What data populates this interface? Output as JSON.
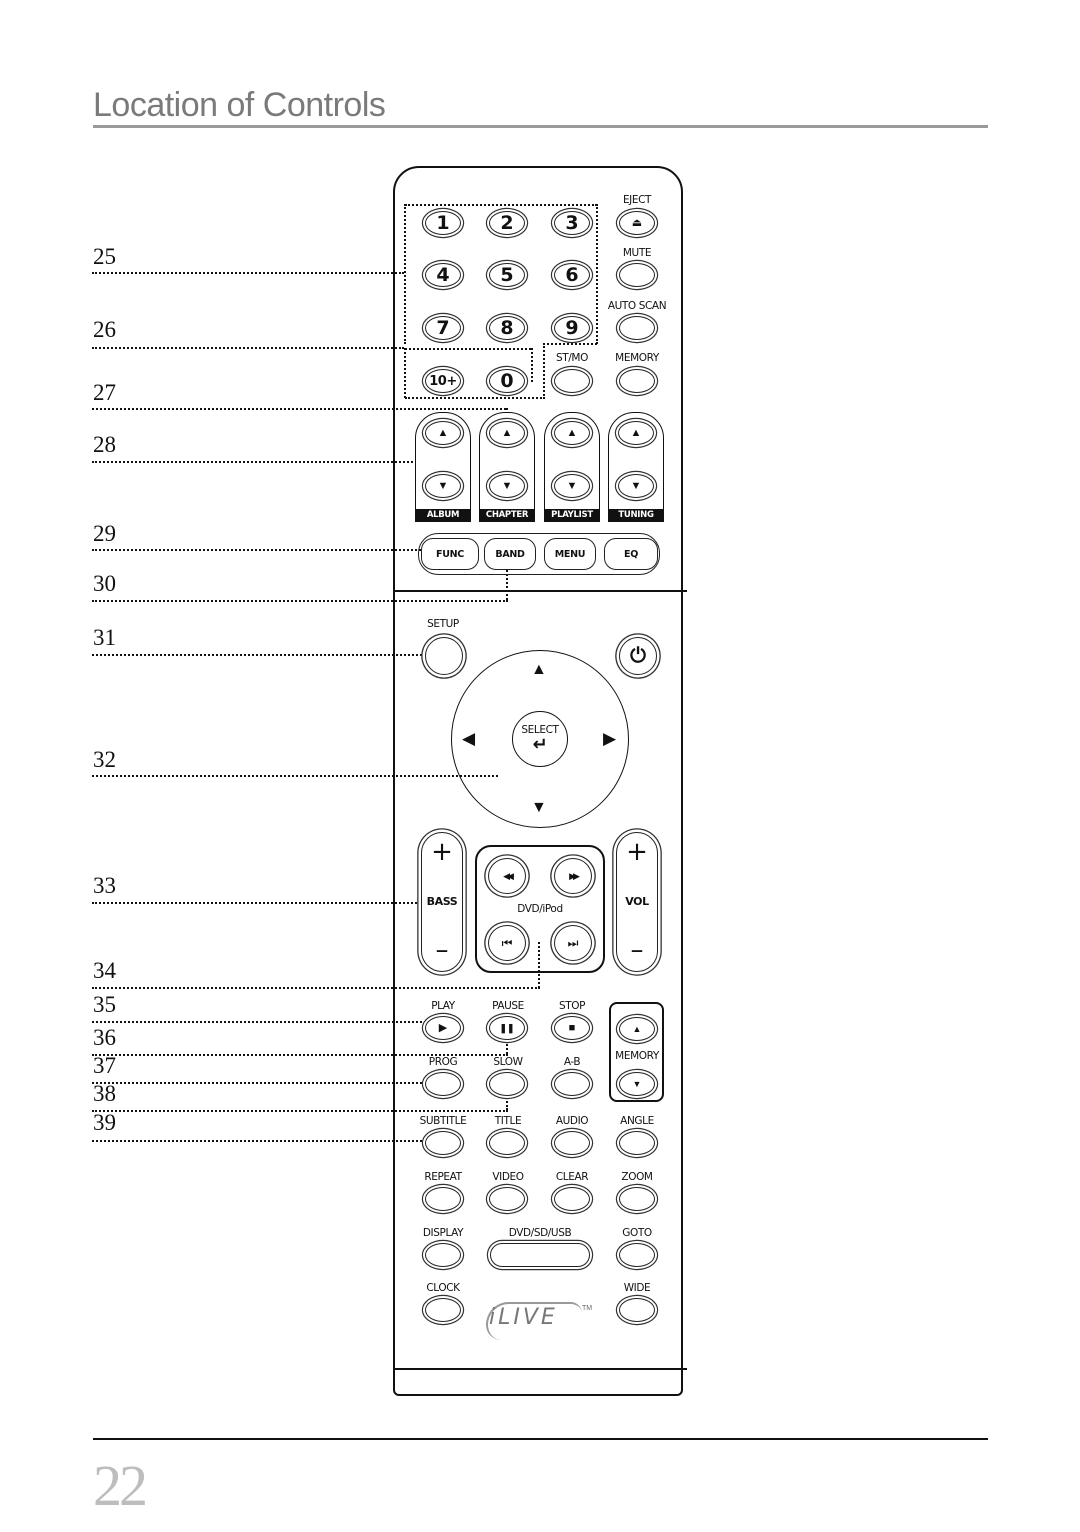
{
  "page": {
    "title": "Location of Controls",
    "page_number": "22"
  },
  "callouts": [
    {
      "number": "25",
      "target": "Number buttons"
    },
    {
      "number": "26",
      "target": "10+ button"
    },
    {
      "number": "27",
      "target": "0 button"
    },
    {
      "number": "28",
      "target": "ALBUM up/down"
    },
    {
      "number": "29",
      "target": "FUNC"
    },
    {
      "number": "30",
      "target": "BAND"
    },
    {
      "number": "31",
      "target": "SETUP"
    },
    {
      "number": "32",
      "target": "Navigation / SELECT"
    },
    {
      "number": "33",
      "target": "BASS +/-"
    },
    {
      "number": "34",
      "target": "Skip"
    },
    {
      "number": "35",
      "target": "PLAY"
    },
    {
      "number": "36",
      "target": "PAUSE"
    },
    {
      "number": "37",
      "target": "PROG"
    },
    {
      "number": "38",
      "target": "SLOW"
    },
    {
      "number": "39",
      "target": "SUBTITLE"
    }
  ],
  "remote": {
    "brand": "iLIVE",
    "trademark": "TM",
    "numpad": [
      "1",
      "2",
      "3",
      "4",
      "5",
      "6",
      "7",
      "8",
      "9",
      "10+",
      "0"
    ],
    "right_column": {
      "eject": "EJECT",
      "mute": "MUTE",
      "auto_scan": "AUTO SCAN",
      "st_mo": "ST/MO",
      "memory": "MEMORY"
    },
    "rockers": [
      "ALBUM",
      "CHAPTER",
      "PLAYLIST",
      "TUNING"
    ],
    "function_row": [
      "FUNC",
      "BAND",
      "MENU",
      "EQ"
    ],
    "setup": "SETUP",
    "power": "power",
    "select": "SELECT",
    "bass": {
      "label": "BASS",
      "plus": "+",
      "minus": "–"
    },
    "vol": {
      "label": "VOL",
      "plus": "+",
      "minus": "–"
    },
    "dvd_ipod": "DVD/iPod",
    "transport": {
      "play": "PLAY",
      "pause": "PAUSE",
      "stop": "STOP",
      "memory": "MEMORY"
    },
    "row_prog": [
      "PROG",
      "SLOW",
      "A-B"
    ],
    "row_subtitle": [
      "SUBTITLE",
      "TITLE",
      "AUDIO",
      "ANGLE"
    ],
    "row_repeat": [
      "REPEAT",
      "VIDEO",
      "CLEAR",
      "ZOOM"
    ],
    "row_display": [
      "DISPLAY",
      "DVD/SD/USB",
      "GOTO"
    ],
    "row_clock": [
      "CLOCK",
      "WIDE"
    ],
    "icons": {
      "eject": "⏏",
      "up": "▲",
      "down": "▼",
      "left": "◀",
      "right": "▶",
      "enter": "↵",
      "power": "⏻",
      "rewind": "◀◀",
      "fast_forward": "▶▶",
      "prev": "⏮",
      "next": "⏭",
      "play": "▶",
      "pause": "❚❚",
      "stop": "■"
    }
  }
}
